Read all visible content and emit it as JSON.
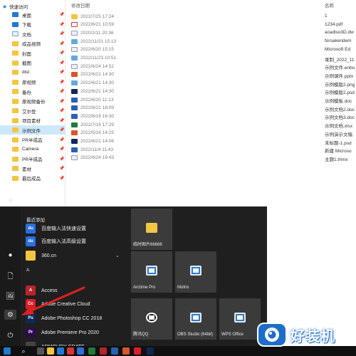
{
  "explorer": {
    "quick_access_label": "快速访问",
    "nav_items": [
      {
        "label": "桌面",
        "icon": "desktop-icon"
      },
      {
        "label": "下载",
        "icon": "download-icon"
      },
      {
        "label": "文档",
        "icon": "document-icon"
      },
      {
        "label": "成品视频",
        "icon": "folder-icon"
      },
      {
        "label": "封面",
        "icon": "folder-icon"
      },
      {
        "label": "截图",
        "icon": "folder-icon"
      },
      {
        "label": "dist",
        "icon": "folder-icon"
      },
      {
        "label": "原视频",
        "icon": "folder-icon"
      },
      {
        "label": "备份",
        "icon": "folder-icon"
      },
      {
        "label": "原视频备份",
        "icon": "folder-icon"
      },
      {
        "label": "艾尔登",
        "icon": "folder-icon"
      },
      {
        "label": "项目素材",
        "icon": "folder-icon"
      },
      {
        "label": "示例文件",
        "icon": "folder-icon"
      },
      {
        "label": "PR半成品",
        "icon": "folder-icon"
      },
      {
        "label": "Camera",
        "icon": "folder-icon"
      },
      {
        "label": "PR半成品",
        "icon": "folder-icon"
      },
      {
        "label": "素材",
        "icon": "folder-icon"
      },
      {
        "label": "最后成品",
        "icon": "folder-icon"
      }
    ],
    "selected_nav_index": 12,
    "pin_glyph": "📌",
    "date_column_header": "修改日期",
    "name_column_header": "名称",
    "files": [
      {
        "date": "2022/7/25 17:24",
        "name": "1",
        "type": "folder"
      },
      {
        "date": "2022/6/21 10:59",
        "name": "1234.pdf",
        "type": "pdf"
      },
      {
        "date": "2020/2/11 20:36",
        "name": "acadiso3D.dw",
        "type": "gen"
      },
      {
        "date": "2022/11/21 15:13",
        "name": "forsakendem",
        "type": "img"
      },
      {
        "date": "2022/6/20 15:15",
        "name": "Microsoft Ed",
        "type": "gen"
      },
      {
        "date": "2022/11/23 10:51",
        "name": "录制_2022_11",
        "type": "img"
      },
      {
        "date": "2022/6/24 14:52",
        "name": "示例文件.enbu",
        "type": "gen"
      },
      {
        "date": "2022/6/21 14:30",
        "name": "示例课件.pptx",
        "type": "ppt"
      },
      {
        "date": "2022/6/21 14:30",
        "name": "示例模版2.png",
        "type": "img"
      },
      {
        "date": "2022/6/21 14:30",
        "name": "示例模版2.psd",
        "type": "ps"
      },
      {
        "date": "2022/6/20 11:13",
        "name": "示例模板.doc",
        "type": "doc"
      },
      {
        "date": "2022/8/22 18:09",
        "name": "示例文档2.doc",
        "type": "doc"
      },
      {
        "date": "2022/6/19 16:30",
        "name": "示例文档3.doc",
        "type": "doc"
      },
      {
        "date": "2022/7/19 17:29",
        "name": "示例文档.xlsx",
        "type": "xls"
      },
      {
        "date": "2022/5/16 14:25",
        "name": "示例演示文稿",
        "type": "ppt"
      },
      {
        "date": "2022/6/21 14:06",
        "name": "未标题-1.psd",
        "type": "ps"
      },
      {
        "date": "2022/11/4 11:43",
        "name": "新建 Microso",
        "type": "doc"
      },
      {
        "date": "2022/6/24 19:43",
        "name": "主题1.thmx",
        "type": "gen"
      }
    ]
  },
  "start_menu": {
    "recently_added_label": "最近添加",
    "section_hash": "#",
    "section_a": "A",
    "apps": [
      {
        "label": "百度输入法快速设置",
        "badge": "du",
        "color": "#2a6fe0"
      },
      {
        "label": "百度输入法高级设置",
        "badge": "du",
        "color": "#2a6fe0"
      },
      {
        "label": "360.cn",
        "badge": "",
        "color": "#f4c542",
        "expand": "⌄"
      },
      {
        "label": "Access",
        "badge": "A",
        "color": "#b7252b"
      },
      {
        "label": "Adobe Creative Cloud",
        "badge": "Cc",
        "color": "#da1f26"
      },
      {
        "label": "Adobe Photoshop CC 2018",
        "badge": "Ps",
        "color": "#0b2a55"
      },
      {
        "label": "Adobe Premiere Pro 2020",
        "badge": "Pr",
        "color": "#2c0a4f"
      },
      {
        "label": "ARMOURY CRATE",
        "badge": "",
        "color": "#444444"
      }
    ],
    "tiles": [
      {
        "label": "临时图片66666",
        "icon": "folder-icon"
      },
      {
        "label": "Arctime Pro",
        "icon": "monitor-icon"
      },
      {
        "label": "Motrix",
        "icon": "monitor-icon"
      },
      {
        "label": "腾讯QQ",
        "icon": "qq-icon"
      },
      {
        "label": "OBS Studio (64bit)",
        "icon": "monitor-icon"
      },
      {
        "label": "WPS Office",
        "icon": "monitor-icon"
      }
    ],
    "rail": [
      {
        "glyph": "≡",
        "name": "hamburger-menu-icon"
      },
      {
        "glyph": "●",
        "name": "user-avatar-icon"
      },
      {
        "glyph": "🗋",
        "name": "documents-icon"
      },
      {
        "glyph": "🖼",
        "name": "pictures-icon"
      },
      {
        "glyph": "⚙",
        "name": "settings-icon"
      },
      {
        "glyph": "⏻",
        "name": "power-icon"
      }
    ]
  },
  "watermark": {
    "text": "好装机"
  },
  "colors": {
    "start_bg": "#1f1f1f",
    "tile_bg": "#3b3b3b",
    "selection": "#cce8ff",
    "accent": "#1e7bd1",
    "arrow": "#e02020"
  }
}
